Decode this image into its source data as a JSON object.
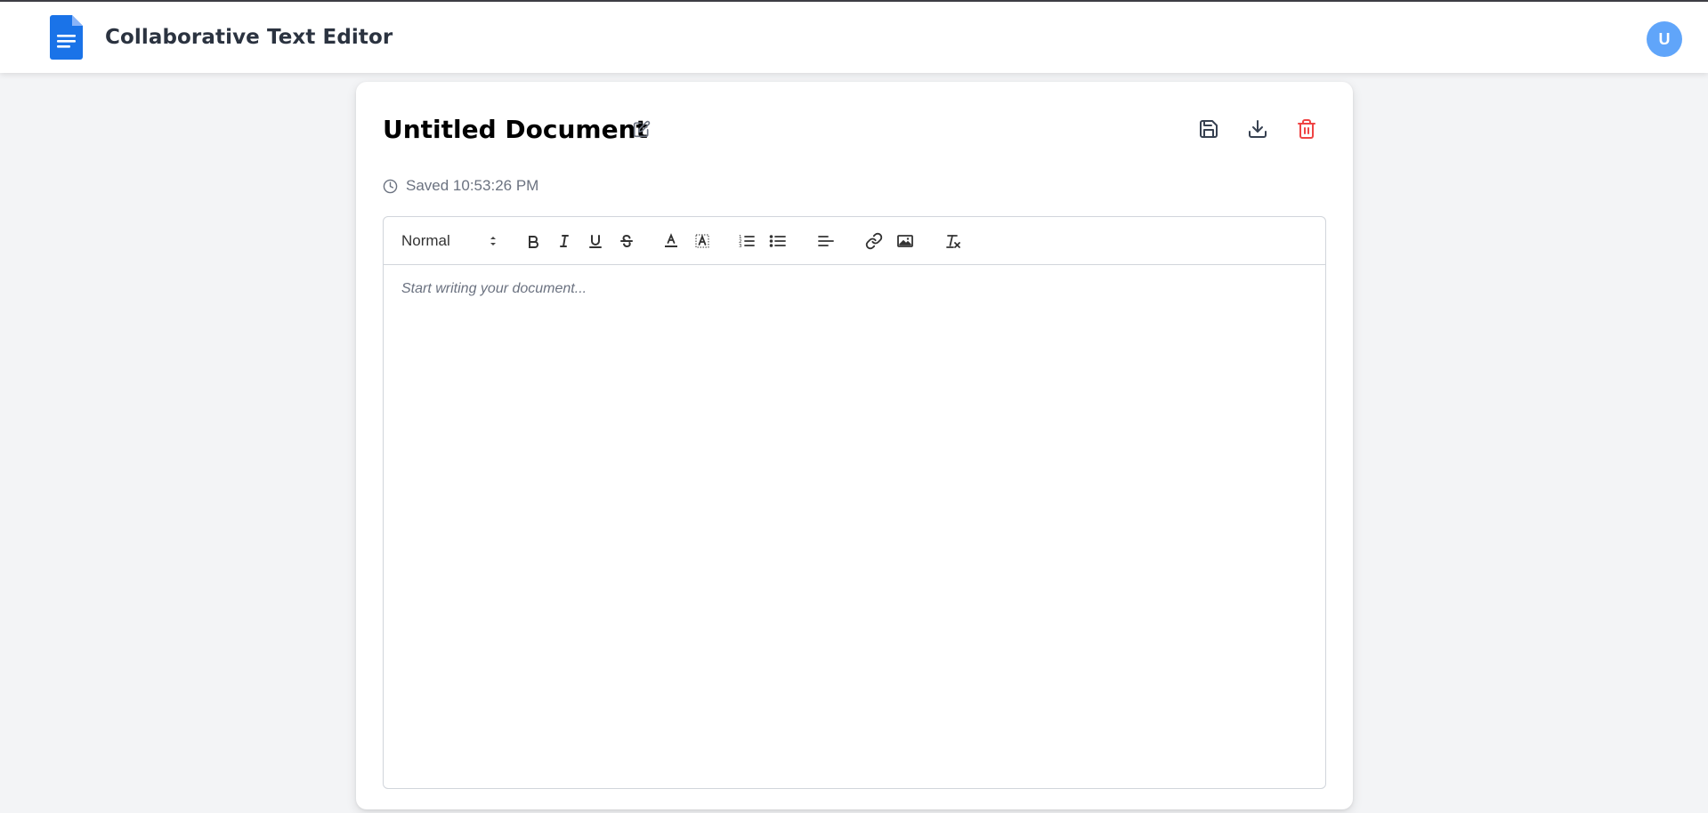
{
  "app": {
    "title": "Collaborative Text Editor",
    "avatar_initial": "U",
    "accent": "#1a73e8"
  },
  "document": {
    "title": "Untitled Document",
    "saved_status": "Saved 10:53:26 PM",
    "placeholder": "Start writing your document..."
  },
  "actions": {
    "icons": [
      "save-icon",
      "download-icon",
      "trash-icon"
    ],
    "delete_color": "#ef4444"
  },
  "toolbar": {
    "format_value": "Normal",
    "buttons": [
      "bold",
      "italic",
      "underline",
      "strike",
      "text-color",
      "background-color",
      "ordered-list",
      "bullet-list",
      "align",
      "link",
      "image",
      "clear-formatting"
    ]
  }
}
